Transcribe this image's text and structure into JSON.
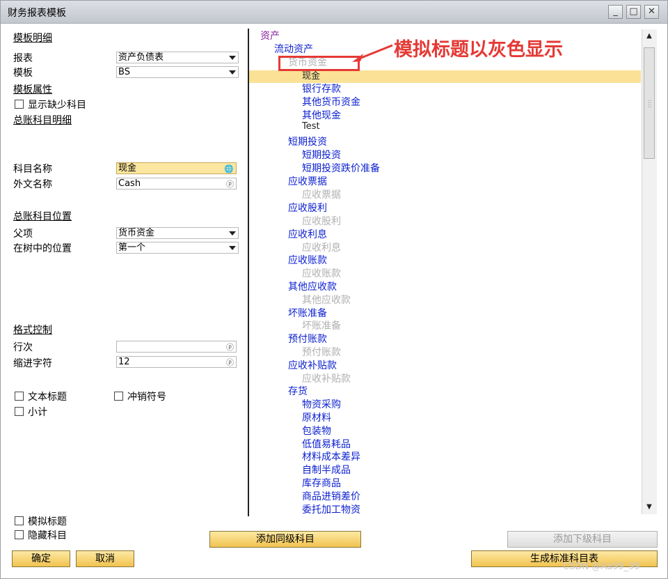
{
  "window": {
    "title": "财务报表模板",
    "buttons": [
      "_",
      "□",
      "✕"
    ]
  },
  "left": {
    "template_details": "模板明细",
    "report_label": "报表",
    "report_value": "资产负债表",
    "template_label": "模板",
    "template_value": "BS",
    "template_props": "模板属性",
    "show_missing": "显示缺少科目",
    "gl_details": "总账科目明细",
    "account_name_label": "科目名称",
    "account_name_value": "现金",
    "foreign_name_label": "外文名称",
    "foreign_name_value": "Cash",
    "gl_position": "总账科目位置",
    "parent_label": "父项",
    "parent_value": "货币资金",
    "tree_pos_label": "在树中的位置",
    "tree_pos_value": "第一个",
    "format_control": "格式控制",
    "row_label": "行次",
    "row_value": "",
    "indent_label": "缩进字符",
    "indent_value": "12",
    "text_title": "文本标题",
    "reverse_sign": "冲销符号",
    "subtotal": "小计",
    "sim_title": "模拟标题",
    "hide_account": "隐藏科目"
  },
  "buttons": {
    "ok": "确定",
    "cancel": "取消",
    "add_same_level": "添加同级科目",
    "add_sub_level": "添加下级科目",
    "gen_standard": "生成标准科目表"
  },
  "tree": {
    "items": [
      {
        "text": "资产"
      },
      {
        "text": "流动资产"
      },
      {
        "text": "货币资金"
      },
      {
        "text": "现金"
      },
      {
        "text": "银行存款"
      },
      {
        "text": "其他货币资金"
      },
      {
        "text": "其他现金"
      },
      {
        "text": "Test"
      },
      {
        "text": "短期投资"
      },
      {
        "text": "短期投资"
      },
      {
        "text": "短期投资跌价准备"
      },
      {
        "text": "应收票据"
      },
      {
        "text": "应收票据"
      },
      {
        "text": "应收股利"
      },
      {
        "text": "应收股利"
      },
      {
        "text": "应收利息"
      },
      {
        "text": "应收利息"
      },
      {
        "text": "应收账款"
      },
      {
        "text": "应收账款"
      },
      {
        "text": "其他应收款"
      },
      {
        "text": "其他应收款"
      },
      {
        "text": "坏账准备"
      },
      {
        "text": "坏账准备"
      },
      {
        "text": "预付账款"
      },
      {
        "text": "预付账款"
      },
      {
        "text": "应收补贴款"
      },
      {
        "text": "应收补贴款"
      },
      {
        "text": "存货"
      },
      {
        "text": "物资采购"
      },
      {
        "text": "原材料"
      },
      {
        "text": "包装物"
      },
      {
        "text": "低值易耗品"
      },
      {
        "text": "材料成本差异"
      },
      {
        "text": "自制半成品"
      },
      {
        "text": "库存商品"
      },
      {
        "text": "商品进销差价"
      },
      {
        "text": "委托加工物资"
      }
    ]
  },
  "annotation": {
    "text": "模拟标题以灰色显示"
  },
  "watermark": "CSDN @Aa99_99",
  "colors": {
    "annotation": "#e53935",
    "tree_link": "#0b1fcf",
    "root": "#8a1f9c",
    "gray": "#b0b0b0",
    "selection": "#fbe196"
  }
}
